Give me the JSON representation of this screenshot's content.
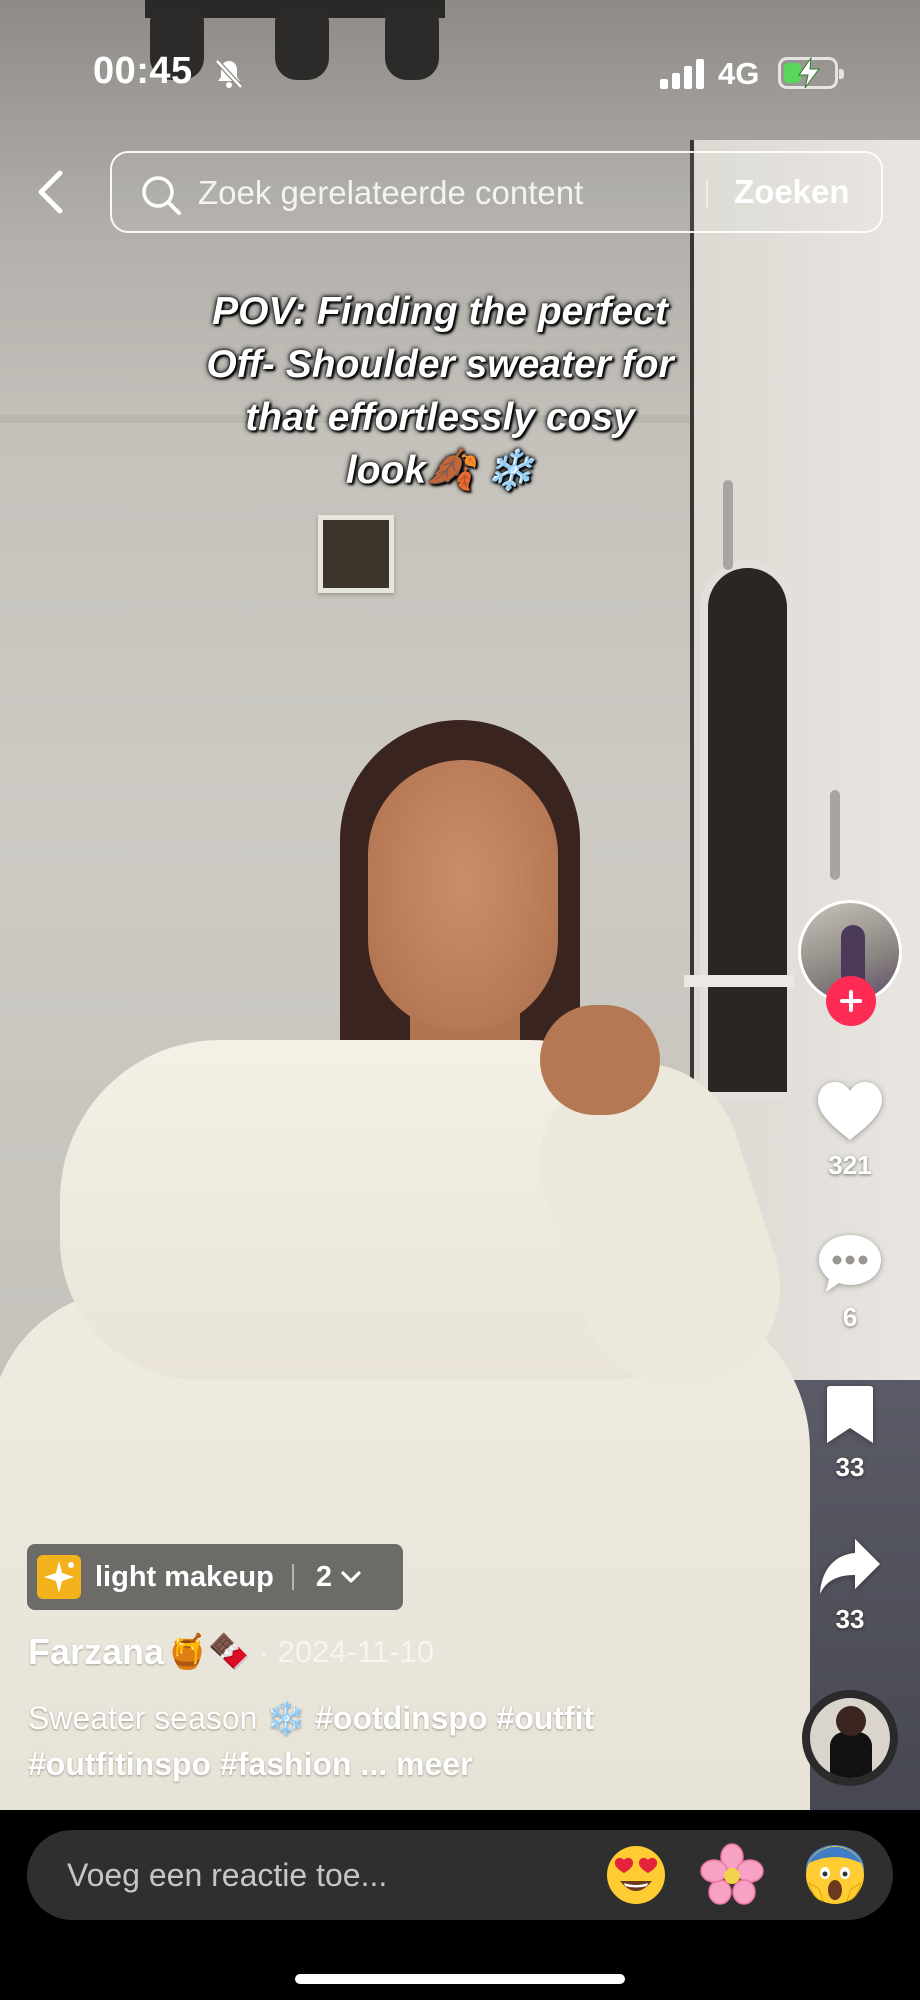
{
  "status_bar": {
    "time": "00:45",
    "network": "4G",
    "silent_icon": "bell-slash-icon",
    "battery_charging": true,
    "battery_level": 0.35
  },
  "search": {
    "placeholder": "Zoek gerelateerde content",
    "button_label": "Zoeken"
  },
  "video": {
    "caption_lines": [
      "POV: Finding the perfect",
      "Off- Shoulder sweater for",
      "that effortlessly cosy",
      "look🍂 ❄️"
    ]
  },
  "actions": {
    "likes": "321",
    "comments": "6",
    "saves": "33",
    "shares": "33",
    "colors": {
      "follow": "#fe2c55",
      "icon": "#ffffff"
    }
  },
  "effect": {
    "label": "light makeup",
    "count": "2"
  },
  "post": {
    "author": "Farzana",
    "author_emojis": "🍯🍫",
    "date": "· 2024-11-10",
    "description_text": "Sweater season ❄️ ",
    "hashtags_line1": "#ootdinspo #outfit",
    "hashtags_line2": "#outfitinspo #fashion",
    "more_label": "... meer"
  },
  "comment_bar": {
    "placeholder": "Voeg een reactie toe...",
    "emojis": [
      "heart-eyes-emoji",
      "cherry-blossom-emoji",
      "screaming-face-emoji"
    ]
  }
}
